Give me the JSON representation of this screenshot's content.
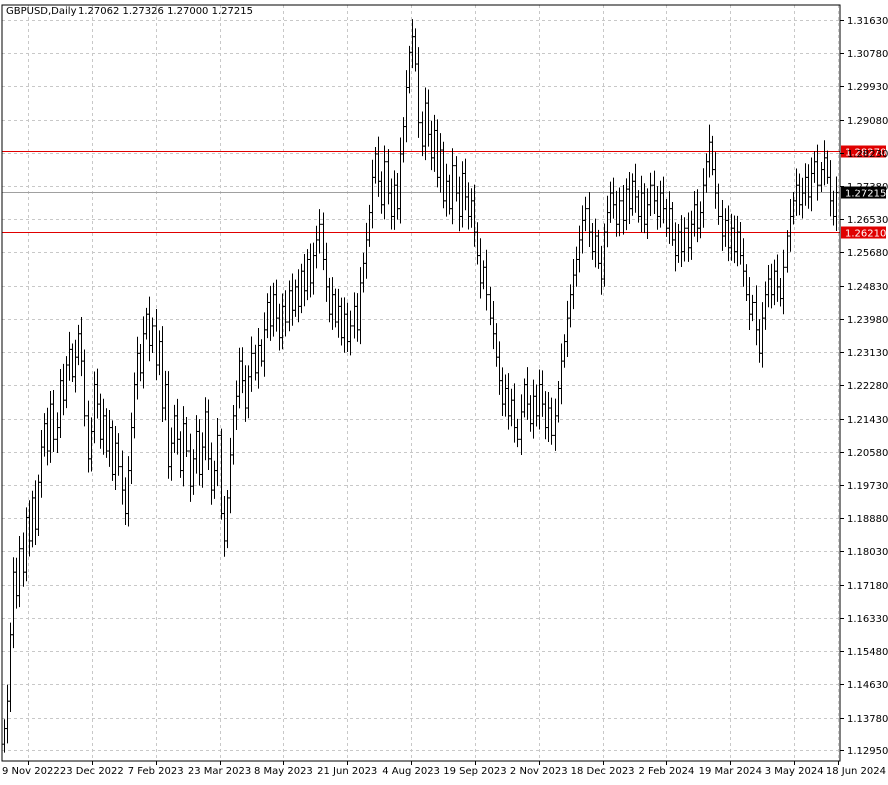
{
  "header": {
    "symbol_timeframe": "GBPUSD,Daily",
    "ohlc": "1.27062 1.27326 1.27000 1.27215"
  },
  "colors": {
    "background": "#ffffff",
    "grid": "#c8c8c8",
    "bars": "#000000",
    "level_line": "#e00000",
    "level_badge": "#e00000",
    "price_badge": "#000000",
    "badge_text": "#ffffff"
  },
  "chart_data": {
    "type": "ohlc",
    "title": "GBPUSD,Daily",
    "ylim": [
      1.1267,
      1.3201
    ],
    "grid": true,
    "y_ticks": [
      "1.31630",
      "1.30780",
      "1.29930",
      "1.29080",
      "1.28230",
      "1.27380",
      "1.26530",
      "1.25680",
      "1.24830",
      "1.23980",
      "1.23130",
      "1.22280",
      "1.21430",
      "1.20580",
      "1.19730",
      "1.18880",
      "1.18030",
      "1.17180",
      "1.16330",
      "1.15480",
      "1.14630",
      "1.13780",
      "1.12950"
    ],
    "x_ticks": [
      "9 Nov 2022",
      "23 Dec 2022",
      "7 Feb 2023",
      "23 Mar 2023",
      "8 May 2023",
      "21 Jun 2023",
      "4 Aug 2023",
      "19 Sep 2023",
      "2 Nov 2023",
      "18 Dec 2023",
      "2 Feb 2024",
      "19 Mar 2024",
      "3 May 2024",
      "18 Jun 2024"
    ],
    "horizontal_levels": [
      {
        "label": "1.28270",
        "value": 1.2827
      },
      {
        "label": "1.26210",
        "value": 1.2621
      }
    ],
    "current_price": {
      "label": "1.27215",
      "value": 1.27215
    },
    "closes": [
      1.135,
      1.142,
      1.159,
      1.175,
      1.169,
      1.181,
      1.175,
      1.189,
      1.183,
      1.194,
      1.186,
      1.198,
      1.207,
      1.213,
      1.206,
      1.218,
      1.209,
      1.212,
      1.224,
      1.219,
      1.228,
      1.232,
      1.225,
      1.23,
      1.236,
      1.229,
      1.215,
      1.204,
      1.211,
      1.223,
      1.218,
      1.209,
      1.215,
      1.206,
      1.212,
      1.2,
      1.208,
      1.202,
      1.196,
      1.19,
      1.201,
      1.212,
      1.223,
      1.231,
      1.226,
      1.236,
      1.241,
      1.233,
      1.238,
      1.228,
      1.234,
      1.217,
      1.223,
      1.202,
      1.208,
      1.215,
      1.209,
      1.201,
      1.213,
      1.206,
      1.197,
      1.204,
      1.211,
      1.2,
      1.207,
      1.216,
      1.204,
      1.196,
      1.201,
      1.21,
      1.19,
      1.183,
      1.194,
      1.205,
      1.215,
      1.22,
      1.229,
      1.224,
      1.217,
      1.225,
      1.231,
      1.226,
      1.233,
      1.229,
      1.237,
      1.244,
      1.238,
      1.246,
      1.24,
      1.235,
      1.243,
      1.239,
      1.247,
      1.242,
      1.248,
      1.243,
      1.252,
      1.247,
      1.255,
      1.249,
      1.256,
      1.26,
      1.264,
      1.255,
      1.248,
      1.241,
      1.246,
      1.239,
      1.243,
      1.235,
      1.241,
      1.234,
      1.238,
      1.243,
      1.237,
      1.249,
      1.254,
      1.26,
      1.267,
      1.276,
      1.282,
      1.275,
      1.269,
      1.28,
      1.272,
      1.266,
      1.274,
      1.268,
      1.282,
      1.289,
      1.299,
      1.308,
      1.312,
      1.305,
      1.29,
      1.284,
      1.295,
      1.287,
      1.281,
      1.288,
      1.276,
      1.283,
      1.27,
      1.275,
      1.268,
      1.279,
      1.272,
      1.266,
      1.277,
      1.271,
      1.266,
      1.27,
      1.262,
      1.256,
      1.249,
      1.253,
      1.246,
      1.24,
      1.236,
      1.23,
      1.224,
      1.218,
      1.222,
      1.215,
      1.219,
      1.212,
      1.209,
      1.216,
      1.223,
      1.218,
      1.213,
      1.22,
      1.215,
      1.223,
      1.218,
      1.212,
      1.217,
      1.21,
      1.215,
      1.222,
      1.229,
      1.234,
      1.24,
      1.246,
      1.251,
      1.255,
      1.26,
      1.265,
      1.268,
      1.262,
      1.257,
      1.261,
      1.254,
      1.25,
      1.262,
      1.267,
      1.272,
      1.269,
      1.264,
      1.27,
      1.265,
      1.273,
      1.268,
      1.275,
      1.271,
      1.266,
      1.272,
      1.264,
      1.269,
      1.274,
      1.27,
      1.266,
      1.272,
      1.268,
      1.263,
      1.268,
      1.26,
      1.256,
      1.262,
      1.257,
      1.263,
      1.258,
      1.264,
      1.269,
      1.263,
      1.267,
      1.274,
      1.28,
      1.285,
      1.278,
      1.272,
      1.266,
      1.261,
      1.265,
      1.258,
      1.263,
      1.257,
      1.262,
      1.256,
      1.252,
      1.246,
      1.241,
      1.244,
      1.237,
      1.231,
      1.24,
      1.246,
      1.25,
      1.246,
      1.252,
      1.248,
      1.245,
      1.253,
      1.261,
      1.266,
      1.27,
      1.274,
      1.269,
      1.272,
      1.276,
      1.271,
      1.277,
      1.28,
      1.274,
      1.278,
      1.281,
      1.276,
      1.27,
      1.266,
      1.2721
    ]
  }
}
